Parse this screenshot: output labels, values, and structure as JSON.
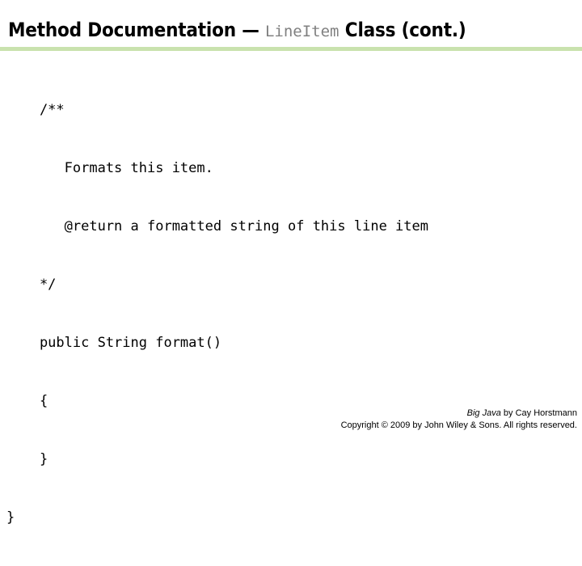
{
  "slide": {
    "title": {
      "prefix": "Method Documentation ",
      "dash": "—",
      "class_name": "LineItem",
      "suffix": " Class (cont.)",
      "class_name_color": "#808080"
    },
    "rule_color": "#c9e2ae",
    "background_color": "#ffffff",
    "code": {
      "language": "java",
      "lines": [
        "    /**",
        "       Formats this item.",
        "       @return a formatted string of this line item",
        "    */",
        "    public String format()",
        "    {",
        "    }",
        "}"
      ],
      "text_color": "#000000"
    },
    "footer": {
      "book_title": "Big Java",
      "attribution": " by Cay Horstmann",
      "copyright": "Copyright © 2009 by John Wiley & Sons.  All rights reserved."
    }
  }
}
